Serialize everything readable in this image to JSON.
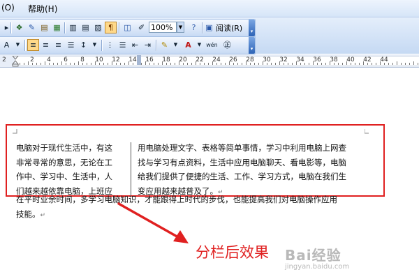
{
  "menu": {
    "items": [
      {
        "label": "(O)",
        "name": "menu-item-format-partial"
      },
      {
        "label": "帮助(H)",
        "name": "menu-item-help"
      }
    ]
  },
  "toolbar_standard": {
    "zoom_value": "100%",
    "read_label": "阅读(R)"
  },
  "toolbar_formatting": {
    "icons": [
      "align-left-icon",
      "align-center-icon",
      "align-right-icon",
      "justify-icon",
      "line-spacing-icon",
      "numbering-icon",
      "bullets-icon",
      "decrease-indent-icon",
      "increase-indent-icon",
      "highlight-icon",
      "font-color-icon",
      "phonetic-guide-icon",
      "enclose-char-icon"
    ]
  },
  "ruler": {
    "numbers": [
      "2",
      "2",
      "4",
      "6",
      "8",
      "10",
      "12",
      "14",
      "16",
      "18",
      "20",
      "22",
      "24",
      "26",
      "28",
      "30",
      "32",
      "34",
      "36",
      "38",
      "40",
      "42",
      "44"
    ]
  },
  "document": {
    "left_column_lines": [
      "电脑对于现代生活中，有这",
      "非常寻常的意思，无论在工",
      "作中、学习中、生活中，人",
      "们越来越依靠电脑，上班应"
    ],
    "right_column_lines": [
      "用电脑处理文字、表格等简单事情，学习中利用电脑上网查",
      "找与学习有点资料，生活中应用电脑聊天、看电影等，电脑",
      "给我们提供了便捷的生活、工作、学习方式，电脑在我们生",
      "变应用越来越普及了。"
    ],
    "below_lines": [
      "在平时业余时间，多学习电脑知识，才能跟得上时代的步伐，也能提高我们对电脑操作应用",
      "技能。"
    ],
    "paragraph_mark": "↵"
  },
  "annotation": {
    "caption": "分栏后效果",
    "watermark": "Bai经验",
    "watermark_sub": "jingyan.baidu.com",
    "highlight_color": "#e02020"
  }
}
